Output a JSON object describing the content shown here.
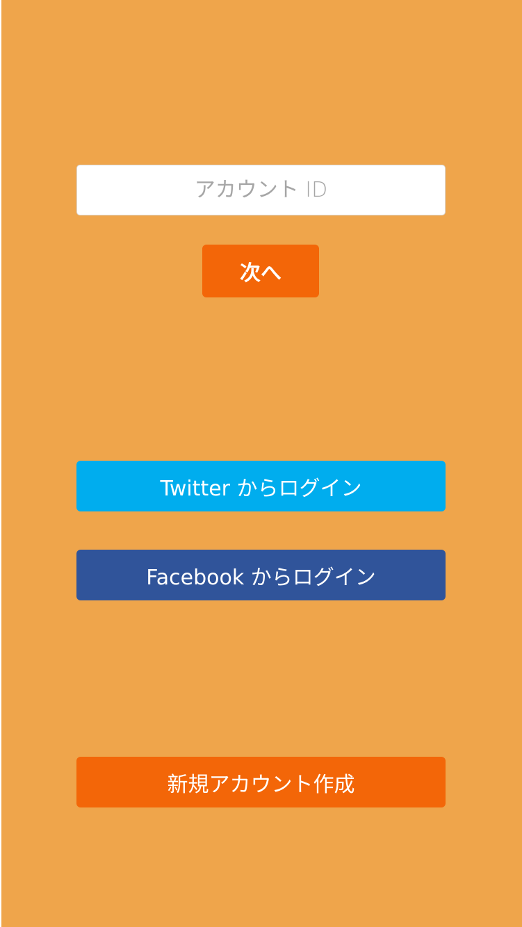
{
  "login": {
    "account_id_placeholder": "アカウント ID",
    "account_id_value": "",
    "next_label": "次へ"
  },
  "social": {
    "twitter_label": "Twitter からログイン",
    "facebook_label": "Facebook からログイン"
  },
  "register": {
    "label": "新規アカウント作成"
  },
  "colors": {
    "background": "#EFA54B",
    "primary": "#F36608",
    "twitter": "#00ADEE",
    "facebook": "#30549A"
  }
}
